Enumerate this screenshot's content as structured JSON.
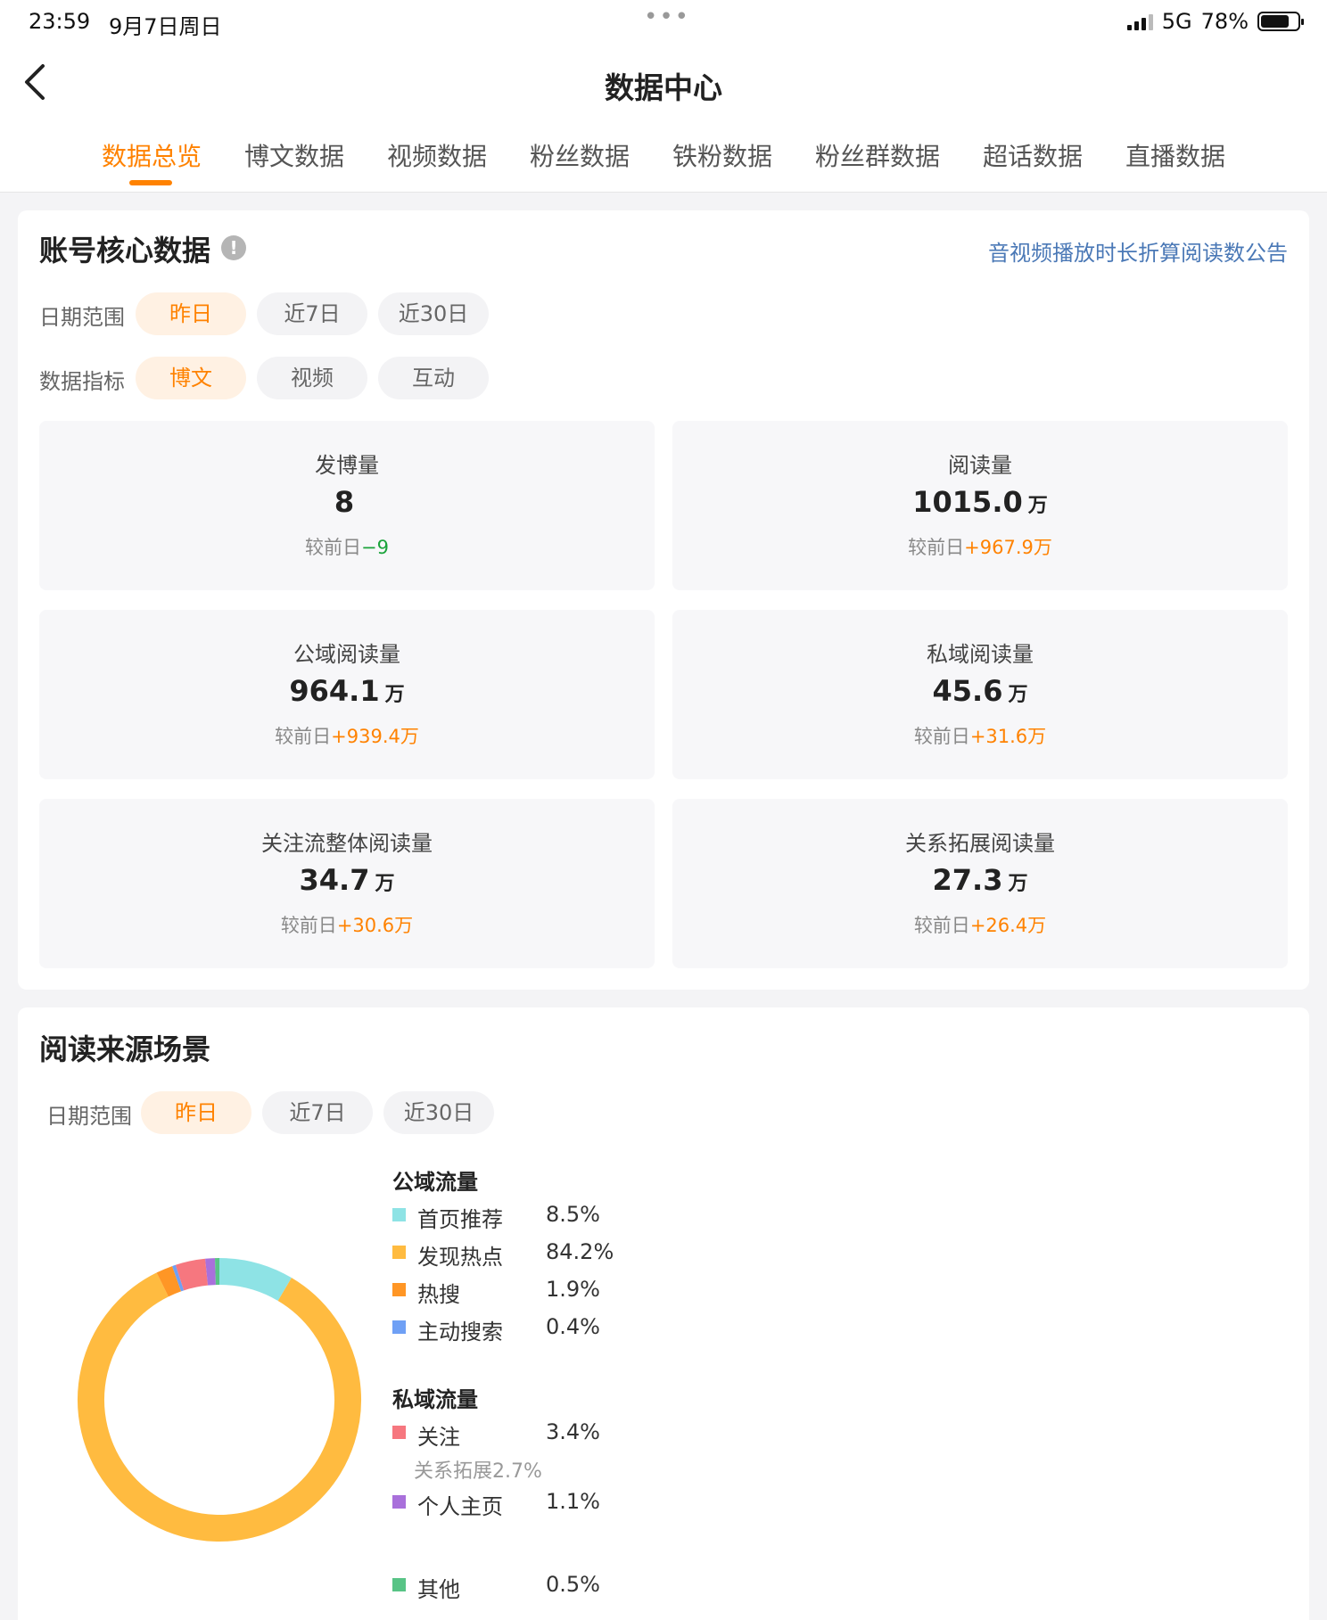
{
  "status": {
    "time": "23:59",
    "date": "9月7日周日",
    "network": "5G",
    "battery": "78%"
  },
  "nav": {
    "title": "数据中心"
  },
  "tabs": [
    "数据总览",
    "博文数据",
    "视频数据",
    "粉丝数据",
    "铁粉数据",
    "粉丝群数据",
    "超话数据",
    "直播数据"
  ],
  "core": {
    "title": "账号核心数据",
    "notice": "音视频播放时长折算阅读数公告",
    "date_label": "日期范围",
    "date_options": [
      "昨日",
      "近7日",
      "近30日"
    ],
    "metric_label": "数据指标",
    "metric_options": [
      "博文",
      "视频",
      "互动"
    ],
    "metrics": [
      {
        "label": "发博量",
        "value": "8",
        "unit": "",
        "compare_prefix": "较前日",
        "compare": "−9"
      },
      {
        "label": "阅读量",
        "value": "1015.0",
        "unit": "万",
        "compare_prefix": "较前日",
        "compare": "+967.9万"
      },
      {
        "label": "公域阅读量",
        "value": "964.1",
        "unit": "万",
        "compare_prefix": "较前日",
        "compare": "+939.4万"
      },
      {
        "label": "私域阅读量",
        "value": "45.6",
        "unit": "万",
        "compare_prefix": "较前日",
        "compare": "+31.6万"
      },
      {
        "label": "关注流整体阅读量",
        "value": "34.7",
        "unit": "万",
        "compare_prefix": "较前日",
        "compare": "+30.6万"
      },
      {
        "label": "关系拓展阅读量",
        "value": "27.3",
        "unit": "万",
        "compare_prefix": "较前日",
        "compare": "+26.4万"
      }
    ]
  },
  "source": {
    "title": "阅读来源场景",
    "date_label": "日期范围",
    "date_options": [
      "昨日",
      "近7日",
      "近30日"
    ],
    "public_label": "公域流量",
    "private_label": "私域流量",
    "sub_note": "关系拓展2.7%",
    "legend": [
      {
        "name": "首页推荐",
        "pct": "8.5%"
      },
      {
        "name": "发现热点",
        "pct": "84.2%"
      },
      {
        "name": "热搜",
        "pct": "1.9%"
      },
      {
        "name": "主动搜索",
        "pct": "0.4%"
      },
      {
        "name": "关注",
        "pct": "3.4%"
      },
      {
        "name": "个人主页",
        "pct": "1.1%"
      },
      {
        "name": "其他",
        "pct": "0.5%"
      }
    ]
  },
  "chart_data": {
    "type": "pie",
    "categories": [
      "首页推荐",
      "发现热点",
      "热搜",
      "主动搜索",
      "关注",
      "个人主页",
      "其他"
    ],
    "values": [
      8.5,
      84.2,
      1.9,
      0.4,
      3.4,
      1.1,
      0.5
    ],
    "colors": [
      "#8ee3e5",
      "#ffbb40",
      "#ff9625",
      "#6fa0f5",
      "#f6777f",
      "#a970db",
      "#58c486"
    ]
  }
}
